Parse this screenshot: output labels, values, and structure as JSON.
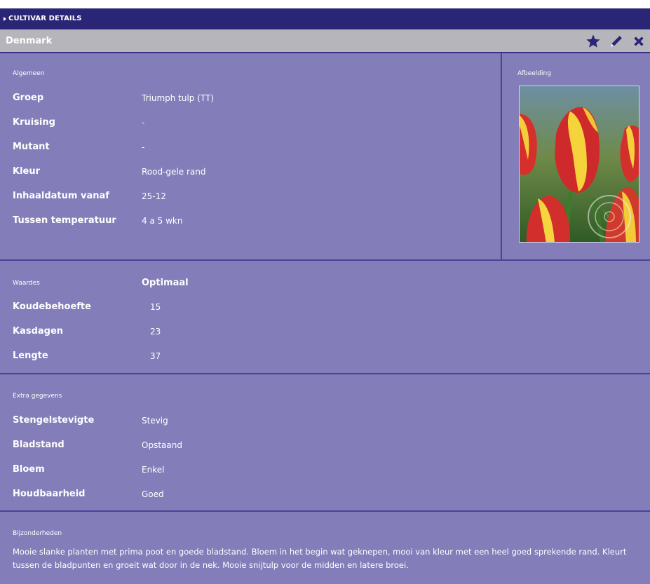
{
  "topbar": {
    "label": "CULTIVAR DETAILS"
  },
  "titlebar": {
    "title": "Denmark"
  },
  "general": {
    "heading": "Algemeen",
    "rows": [
      {
        "label": "Groep",
        "value": "Triumph tulp (TT)"
      },
      {
        "label": "Kruising",
        "value": "-"
      },
      {
        "label": "Mutant",
        "value": "-"
      },
      {
        "label": "Kleur",
        "value": "Rood-gele rand"
      },
      {
        "label": "Inhaaldatum vanaf",
        "value": "25-12"
      },
      {
        "label": "Tussen temperatuur",
        "value": "4 a 5 wkn"
      }
    ],
    "image_heading": "Afbeelding"
  },
  "values": {
    "heading": "Waardes",
    "column": "Optimaal",
    "rows": [
      {
        "label": "Koudebehoefte",
        "value": "15"
      },
      {
        "label": "Kasdagen",
        "value": "23"
      },
      {
        "label": "Lengte",
        "value": "37"
      }
    ]
  },
  "extra": {
    "heading": "Extra gegevens",
    "rows": [
      {
        "label": "Stengelstevigte",
        "value": "Stevig"
      },
      {
        "label": "Bladstand",
        "value": "Opstaand"
      },
      {
        "label": "Bloem",
        "value": "Enkel"
      },
      {
        "label": "Houdbaarheid",
        "value": "Goed"
      }
    ]
  },
  "notes": {
    "heading": "Bijzonderheden",
    "text": "Mooie slanke planten met prima poot en goede bladstand. Bloem in het begin wat geknepen, mooi van kleur met een heel goed sprekende rand. Kleurt tussen de bladpunten en groeit wat door in de nek. Mooie snijtulp voor de midden en latere broei."
  },
  "icons": {
    "favorite": "star-icon",
    "edit": "pencil-icon",
    "close": "close-icon"
  },
  "colors": {
    "topbar": "#2a2574",
    "titlebar": "#b5b5bb",
    "panel": "#837db9",
    "divider": "#4a4296",
    "icon": "#2a2574"
  }
}
